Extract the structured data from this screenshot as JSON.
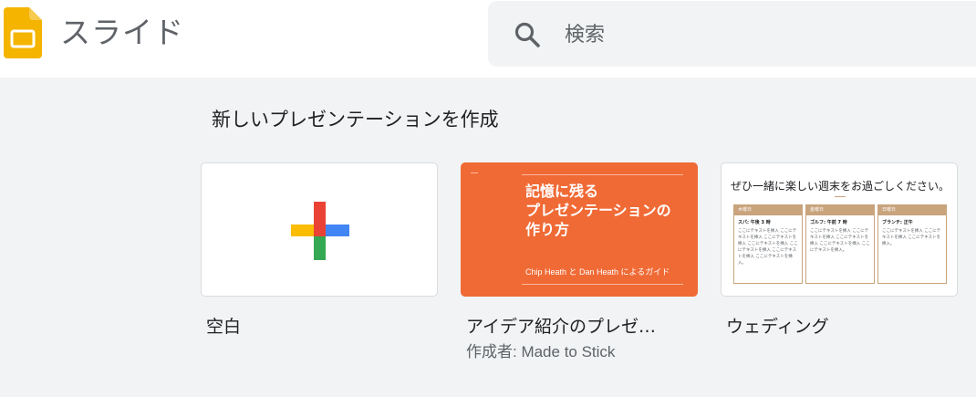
{
  "header": {
    "app_name": "スライド",
    "search_placeholder": "検索"
  },
  "section": {
    "title": "新しいプレゼンテーションを作成"
  },
  "templates": [
    {
      "title": "空白"
    },
    {
      "title": "アイデア紹介のプレゼ…",
      "author": "作成者: Made to Stick",
      "thumb_heading_line1": "記憶に残る",
      "thumb_heading_line2": "プレゼンテーションの",
      "thumb_heading_line3": "作り方",
      "thumb_sub": "Chip Heath と Dan Heath によるガイド"
    },
    {
      "title": "ウェディング",
      "thumb_heading": "ぜひ一緒に楽しい週末をお過ごしください。",
      "columns": [
        {
          "day": "木曜日",
          "event": "スパ: 午後 3 時",
          "text": "ここにテキストを挿入 ここにテキストを挿入 ここにテキストを挿入 ここにテキストを挿入 ここにテキストを挿入 ここにテキストを挿入 ここにテキストを挿入。"
        },
        {
          "day": "金曜日",
          "event": "ゴルフ: 午前 7 時",
          "text": "ここにテキストを挿入 ここにテキストを挿入 ここにテキストを挿入 ここにテキストを挿入 ここにテキストを挿入。"
        },
        {
          "day": "日曜日",
          "event": "ブランチ: 正午",
          "text": "ここにテキストを挿入 ここにテキストを挿入 ここにテキストを挿入。"
        }
      ]
    }
  ],
  "colors": {
    "logo_yellow": "#f4b400",
    "plus_red": "#ea4335",
    "plus_blue": "#4285f4",
    "plus_green": "#34a853",
    "plus_yellow": "#fbbc04",
    "orange_template": "#f06a35",
    "wedding_accent": "#c8a37c"
  },
  "icons": {
    "logo": "slides-logo-icon",
    "search": "search-icon",
    "blank": "plus-icon"
  }
}
